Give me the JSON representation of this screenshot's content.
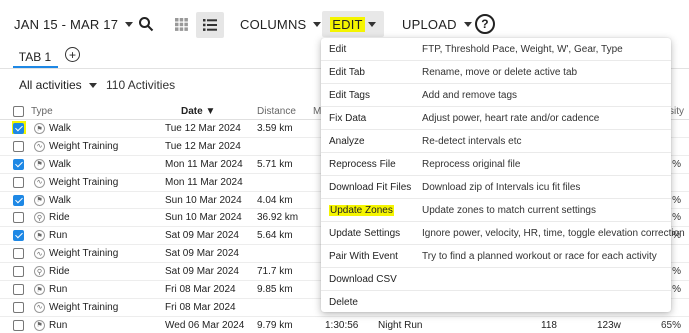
{
  "toolbar": {
    "date_range": "JAN 15 - MAR 17",
    "columns": "COLUMNS",
    "edit": "EDIT",
    "upload": "UPLOAD",
    "help": "?"
  },
  "tabs": {
    "tab1": "TAB 1",
    "add": "+"
  },
  "filter": {
    "label": "All activities",
    "count": "110 Activities"
  },
  "table": {
    "headers": {
      "type": "Type",
      "date": "Date ▼",
      "distance": "Distance",
      "m": "M",
      "sity": "sity"
    },
    "rows": [
      {
        "type": "Walk",
        "date": "Tue 12 Mar 2024",
        "distance": "3.59 km",
        "tail": "",
        "checked": true
      },
      {
        "type": "Weight Training",
        "date": "Tue 12 Mar 2024",
        "distance": "",
        "tail": "",
        "checked": false
      },
      {
        "type": "Walk",
        "date": "Mon 11 Mar 2024",
        "distance": "5.71 km",
        "tail": "%",
        "checked": true
      },
      {
        "type": "Weight Training",
        "date": "Mon 11 Mar 2024",
        "distance": "",
        "tail": "",
        "checked": false
      },
      {
        "type": "Walk",
        "date": "Sun 10 Mar 2024",
        "distance": "4.04 km",
        "tail": "%",
        "checked": true
      },
      {
        "type": "Ride",
        "date": "Sun 10 Mar 2024",
        "distance": "36.92 km",
        "tail": "%",
        "checked": false
      },
      {
        "type": "Run",
        "date": "Sat 09 Mar 2024",
        "distance": "5.64 km",
        "tail": "%",
        "checked": true
      },
      {
        "type": "Weight Training",
        "date": "Sat 09 Mar 2024",
        "distance": "",
        "tail": "",
        "checked": false
      },
      {
        "type": "Ride",
        "date": "Sat 09 Mar 2024",
        "distance": "71.7 km",
        "tail": "%",
        "checked": false
      },
      {
        "type": "Run",
        "date": "Fri 08 Mar 2024",
        "distance": "9.85 km",
        "tail": "%",
        "checked": false
      },
      {
        "type": "Weight Training",
        "date": "Fri 08 Mar 2024",
        "distance": "",
        "tail": "",
        "checked": false
      },
      {
        "type": "Run",
        "date": "Wed 06 Mar 2024",
        "distance": "9.79 km",
        "tail": "65%",
        "checked": false
      }
    ],
    "last_row_extra": {
      "time": "1:30:56",
      "name": "Night Run",
      "hr": "118",
      "power": "123w"
    }
  },
  "menu": {
    "items": [
      {
        "label": "Edit",
        "desc": "FTP, Threshold Pace, Weight, W', Gear, Type"
      },
      {
        "label": "Edit Tab",
        "desc": "Rename, move or delete active tab"
      },
      {
        "label": "Edit Tags",
        "desc": "Add and remove tags"
      },
      {
        "label": "Fix Data",
        "desc": "Adjust power, heart rate and/or cadence"
      },
      {
        "label": "Analyze",
        "desc": "Re-detect intervals etc"
      },
      {
        "label": "Reprocess File",
        "desc": "Reprocess original file"
      },
      {
        "label": "Download Fit Files",
        "desc": "Download zip of Intervals icu fit files"
      },
      {
        "label": "Update Zones",
        "desc": "Update zones to match current settings"
      },
      {
        "label": "Update Settings",
        "desc": "Ignore power, velocity, HR, time, toggle elevation correction"
      },
      {
        "label": "Pair With Event",
        "desc": "Try to find a planned workout or race for each activity"
      },
      {
        "label": "Download CSV",
        "desc": ""
      },
      {
        "label": "Delete",
        "desc": ""
      }
    ]
  },
  "colors": {
    "highlight": "#f5f500",
    "accent": "#1e88e5"
  }
}
